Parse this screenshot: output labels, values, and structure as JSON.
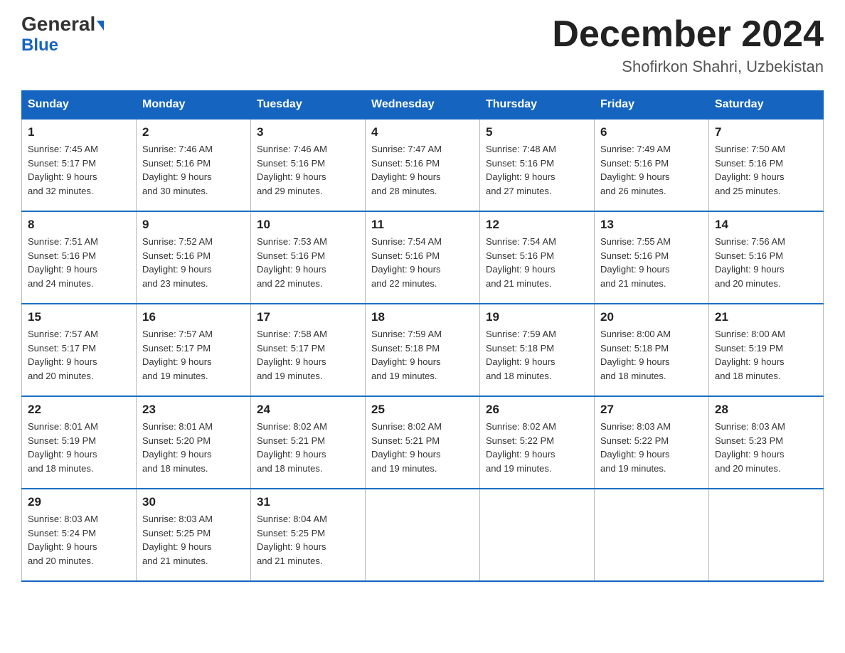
{
  "header": {
    "logo_general": "General",
    "logo_blue": "Blue",
    "month_title": "December 2024",
    "subtitle": "Shofirkon Shahri, Uzbekistan"
  },
  "weekdays": [
    "Sunday",
    "Monday",
    "Tuesday",
    "Wednesday",
    "Thursday",
    "Friday",
    "Saturday"
  ],
  "weeks": [
    [
      {
        "day": "1",
        "sunrise": "7:45 AM",
        "sunset": "5:17 PM",
        "daylight": "9 hours and 32 minutes."
      },
      {
        "day": "2",
        "sunrise": "7:46 AM",
        "sunset": "5:16 PM",
        "daylight": "9 hours and 30 minutes."
      },
      {
        "day": "3",
        "sunrise": "7:46 AM",
        "sunset": "5:16 PM",
        "daylight": "9 hours and 29 minutes."
      },
      {
        "day": "4",
        "sunrise": "7:47 AM",
        "sunset": "5:16 PM",
        "daylight": "9 hours and 28 minutes."
      },
      {
        "day": "5",
        "sunrise": "7:48 AM",
        "sunset": "5:16 PM",
        "daylight": "9 hours and 27 minutes."
      },
      {
        "day": "6",
        "sunrise": "7:49 AM",
        "sunset": "5:16 PM",
        "daylight": "9 hours and 26 minutes."
      },
      {
        "day": "7",
        "sunrise": "7:50 AM",
        "sunset": "5:16 PM",
        "daylight": "9 hours and 25 minutes."
      }
    ],
    [
      {
        "day": "8",
        "sunrise": "7:51 AM",
        "sunset": "5:16 PM",
        "daylight": "9 hours and 24 minutes."
      },
      {
        "day": "9",
        "sunrise": "7:52 AM",
        "sunset": "5:16 PM",
        "daylight": "9 hours and 23 minutes."
      },
      {
        "day": "10",
        "sunrise": "7:53 AM",
        "sunset": "5:16 PM",
        "daylight": "9 hours and 22 minutes."
      },
      {
        "day": "11",
        "sunrise": "7:54 AM",
        "sunset": "5:16 PM",
        "daylight": "9 hours and 22 minutes."
      },
      {
        "day": "12",
        "sunrise": "7:54 AM",
        "sunset": "5:16 PM",
        "daylight": "9 hours and 21 minutes."
      },
      {
        "day": "13",
        "sunrise": "7:55 AM",
        "sunset": "5:16 PM",
        "daylight": "9 hours and 21 minutes."
      },
      {
        "day": "14",
        "sunrise": "7:56 AM",
        "sunset": "5:16 PM",
        "daylight": "9 hours and 20 minutes."
      }
    ],
    [
      {
        "day": "15",
        "sunrise": "7:57 AM",
        "sunset": "5:17 PM",
        "daylight": "9 hours and 20 minutes."
      },
      {
        "day": "16",
        "sunrise": "7:57 AM",
        "sunset": "5:17 PM",
        "daylight": "9 hours and 19 minutes."
      },
      {
        "day": "17",
        "sunrise": "7:58 AM",
        "sunset": "5:17 PM",
        "daylight": "9 hours and 19 minutes."
      },
      {
        "day": "18",
        "sunrise": "7:59 AM",
        "sunset": "5:18 PM",
        "daylight": "9 hours and 19 minutes."
      },
      {
        "day": "19",
        "sunrise": "7:59 AM",
        "sunset": "5:18 PM",
        "daylight": "9 hours and 18 minutes."
      },
      {
        "day": "20",
        "sunrise": "8:00 AM",
        "sunset": "5:18 PM",
        "daylight": "9 hours and 18 minutes."
      },
      {
        "day": "21",
        "sunrise": "8:00 AM",
        "sunset": "5:19 PM",
        "daylight": "9 hours and 18 minutes."
      }
    ],
    [
      {
        "day": "22",
        "sunrise": "8:01 AM",
        "sunset": "5:19 PM",
        "daylight": "9 hours and 18 minutes."
      },
      {
        "day": "23",
        "sunrise": "8:01 AM",
        "sunset": "5:20 PM",
        "daylight": "9 hours and 18 minutes."
      },
      {
        "day": "24",
        "sunrise": "8:02 AM",
        "sunset": "5:21 PM",
        "daylight": "9 hours and 18 minutes."
      },
      {
        "day": "25",
        "sunrise": "8:02 AM",
        "sunset": "5:21 PM",
        "daylight": "9 hours and 19 minutes."
      },
      {
        "day": "26",
        "sunrise": "8:02 AM",
        "sunset": "5:22 PM",
        "daylight": "9 hours and 19 minutes."
      },
      {
        "day": "27",
        "sunrise": "8:03 AM",
        "sunset": "5:22 PM",
        "daylight": "9 hours and 19 minutes."
      },
      {
        "day": "28",
        "sunrise": "8:03 AM",
        "sunset": "5:23 PM",
        "daylight": "9 hours and 20 minutes."
      }
    ],
    [
      {
        "day": "29",
        "sunrise": "8:03 AM",
        "sunset": "5:24 PM",
        "daylight": "9 hours and 20 minutes."
      },
      {
        "day": "30",
        "sunrise": "8:03 AM",
        "sunset": "5:25 PM",
        "daylight": "9 hours and 21 minutes."
      },
      {
        "day": "31",
        "sunrise": "8:04 AM",
        "sunset": "5:25 PM",
        "daylight": "9 hours and 21 minutes."
      },
      null,
      null,
      null,
      null
    ]
  ]
}
